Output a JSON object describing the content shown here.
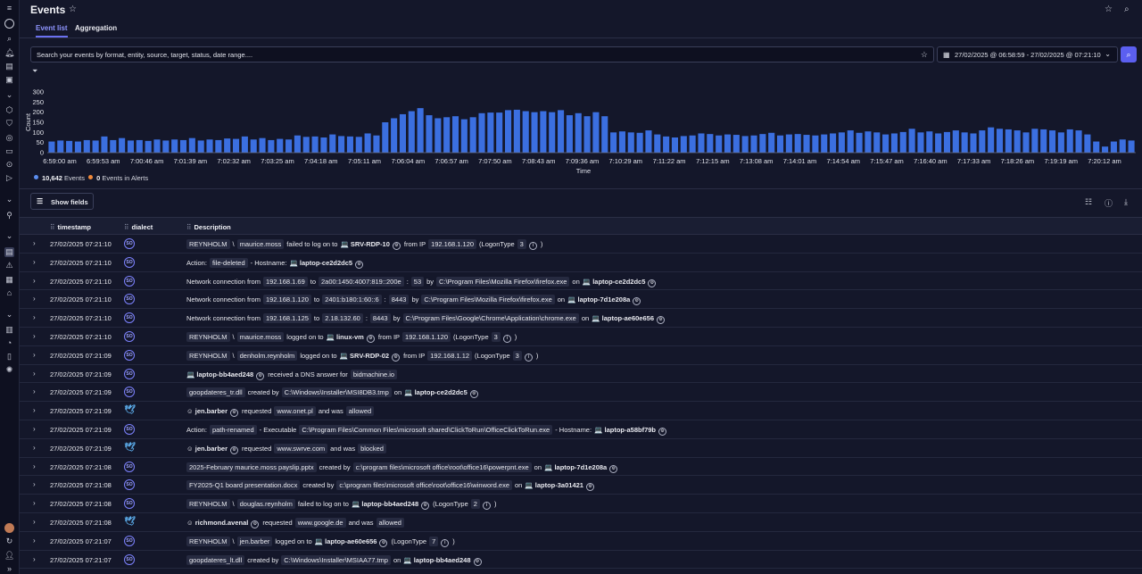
{
  "header": {
    "title": "Events"
  },
  "tabs": [
    {
      "label": "Event list"
    },
    {
      "label": "Aggregation"
    }
  ],
  "search": {
    "placeholder": "Search your events by format, entity, source, target, status, date range...."
  },
  "date_range": "27/02/2025 @ 06:58:59 - 27/02/2025 @ 07:21:10",
  "legend": {
    "events_count": "10,642",
    "events_label": "Events",
    "alerts_count": "0",
    "alerts_label": "Events in Alerts",
    "events_color": "#5b8def",
    "alerts_color": "#f0893a"
  },
  "table": {
    "show_fields_label": "Show fields",
    "columns": [
      "timestamp",
      "dialect",
      "Description"
    ]
  },
  "chart_data": {
    "type": "bar",
    "ylabel": "Count",
    "xlabel": "Time",
    "ylim": [
      0,
      300
    ],
    "yticks": [
      0,
      50,
      100,
      150,
      200,
      250,
      300
    ],
    "xticks": [
      "6:59:00 am",
      "6:59:53 am",
      "7:00:46 am",
      "7:01:39 am",
      "7:02:32 am",
      "7:03:25 am",
      "7:04:18 am",
      "7:05:11 am",
      "7:06:04 am",
      "7:06:57 am",
      "7:07:50 am",
      "7:08:43 am",
      "7:09:36 am",
      "7:10:29 am",
      "7:11:22 am",
      "7:12:15 am",
      "7:13:08 am",
      "7:14:01 am",
      "7:14:54 am",
      "7:15:47 am",
      "7:16:40 am",
      "7:17:33 am",
      "7:18:26 am",
      "7:19:19 am",
      "7:20:12 am"
    ],
    "color": "#3b6fe0",
    "values": [
      55,
      60,
      58,
      55,
      62,
      60,
      80,
      62,
      72,
      60,
      62,
      58,
      65,
      60,
      65,
      62,
      72,
      60,
      65,
      62,
      70,
      68,
      80,
      65,
      72,
      62,
      68,
      65,
      85,
      78,
      80,
      75,
      90,
      82,
      80,
      78,
      95,
      85,
      150,
      170,
      190,
      205,
      220,
      185,
      170,
      175,
      180,
      165,
      175,
      195,
      198,
      198,
      210,
      212,
      205,
      200,
      205,
      200,
      210,
      185,
      195,
      180,
      200,
      180,
      100,
      105,
      100,
      98,
      110,
      90,
      80,
      75,
      82,
      85,
      95,
      92,
      85,
      90,
      88,
      82,
      85,
      92,
      98,
      85,
      90,
      92,
      88,
      85,
      90,
      95,
      100,
      110,
      98,
      105,
      100,
      90,
      95,
      102,
      118,
      100,
      105,
      95,
      102,
      110,
      100,
      95,
      110,
      125,
      118,
      115,
      110,
      100,
      118,
      115,
      110,
      100,
      115,
      110,
      90,
      55,
      30,
      55,
      65,
      60
    ]
  },
  "rows": [
    {
      "ts": "27/02/2025 07:21:10",
      "dialect": "SO",
      "desc": [
        [
          "c",
          "REYNHOLM"
        ],
        [
          "t",
          "\\"
        ],
        [
          "c",
          "maurice.moss"
        ],
        [
          "t",
          "failed to log on to"
        ],
        [
          "h",
          "💻 SRV-RDP-10"
        ],
        [
          "o",
          "⚙"
        ],
        [
          "t",
          "from IP"
        ],
        [
          "c",
          "192.168.1.120"
        ],
        [
          "t",
          "(LogonType"
        ],
        [
          "c",
          "3"
        ],
        [
          "i",
          "i"
        ],
        [
          "t",
          ")"
        ]
      ]
    },
    {
      "ts": "27/02/2025 07:21:10",
      "dialect": "SO",
      "desc": [
        [
          "t",
          "Action:"
        ],
        [
          "c",
          "file-deleted"
        ],
        [
          "t",
          "- Hostname:"
        ],
        [
          "h",
          "💻 laptop-ce2d2dc5"
        ],
        [
          "o",
          "⚙"
        ]
      ]
    },
    {
      "ts": "27/02/2025 07:21:10",
      "dialect": "SO",
      "desc": [
        [
          "t",
          "Network connection from"
        ],
        [
          "c",
          "192.168.1.69"
        ],
        [
          "t",
          "to"
        ],
        [
          "c",
          "2a00:1450:4007:819::200e"
        ],
        [
          "t",
          ":"
        ],
        [
          "c",
          "53"
        ],
        [
          "t",
          "by"
        ],
        [
          "c",
          "C:\\Program Files\\Mozilla Firefox\\firefox.exe"
        ],
        [
          "t",
          "on"
        ],
        [
          "h",
          "💻 laptop-ce2d2dc5"
        ],
        [
          "o",
          "⚙"
        ]
      ]
    },
    {
      "ts": "27/02/2025 07:21:10",
      "dialect": "SO",
      "desc": [
        [
          "t",
          "Network connection from"
        ],
        [
          "c",
          "192.168.1.120"
        ],
        [
          "t",
          "to"
        ],
        [
          "c",
          "2401:b180:1:60::6"
        ],
        [
          "t",
          ":"
        ],
        [
          "c",
          "8443"
        ],
        [
          "t",
          "by"
        ],
        [
          "c",
          "C:\\Program Files\\Mozilla Firefox\\firefox.exe"
        ],
        [
          "t",
          "on"
        ],
        [
          "h",
          "💻 laptop-7d1e208a"
        ],
        [
          "o",
          "⚙"
        ]
      ]
    },
    {
      "ts": "27/02/2025 07:21:10",
      "dialect": "SO",
      "desc": [
        [
          "t",
          "Network connection from"
        ],
        [
          "c",
          "192.168.1.125"
        ],
        [
          "t",
          "to"
        ],
        [
          "c",
          "2.18.132.60"
        ],
        [
          "t",
          ":"
        ],
        [
          "c",
          "8443"
        ],
        [
          "t",
          "by"
        ],
        [
          "c",
          "C:\\Program Files\\Google\\Chrome\\Application\\chrome.exe"
        ],
        [
          "t",
          "on"
        ],
        [
          "h",
          "💻 laptop-ae60e656"
        ],
        [
          "o",
          "⚙"
        ]
      ]
    },
    {
      "ts": "27/02/2025 07:21:10",
      "dialect": "SO",
      "desc": [
        [
          "c",
          "REYNHOLM"
        ],
        [
          "t",
          "\\"
        ],
        [
          "c",
          "maurice.moss"
        ],
        [
          "t",
          "logged on to"
        ],
        [
          "h",
          "💻 linux-vm"
        ],
        [
          "o",
          "⚙"
        ],
        [
          "t",
          "from IP"
        ],
        [
          "c",
          "192.168.1.120"
        ],
        [
          "t",
          "(LogonType"
        ],
        [
          "c",
          "3"
        ],
        [
          "i",
          "i"
        ],
        [
          "t",
          ")"
        ]
      ]
    },
    {
      "ts": "27/02/2025 07:21:09",
      "dialect": "SO",
      "desc": [
        [
          "c",
          "REYNHOLM"
        ],
        [
          "t",
          "\\"
        ],
        [
          "c",
          "denholm.reynholm"
        ],
        [
          "t",
          "logged on to"
        ],
        [
          "h",
          "💻 SRV-RDP-02"
        ],
        [
          "o",
          "⚙"
        ],
        [
          "t",
          "from IP"
        ],
        [
          "c",
          "192.168.1.12"
        ],
        [
          "t",
          "(LogonType"
        ],
        [
          "c",
          "3"
        ],
        [
          "i",
          "i"
        ],
        [
          "t",
          ")"
        ]
      ]
    },
    {
      "ts": "27/02/2025 07:21:09",
      "dialect": "SO",
      "desc": [
        [
          "h",
          "💻 laptop-bb4aed248"
        ],
        [
          "o",
          "⚙"
        ],
        [
          "t",
          "received a DNS answer for"
        ],
        [
          "c",
          "bidmachine.io"
        ]
      ]
    },
    {
      "ts": "27/02/2025 07:21:09",
      "dialect": "SO",
      "desc": [
        [
          "c",
          "goopdateres_tr.dll"
        ],
        [
          "t",
          "created by"
        ],
        [
          "c",
          "C:\\Windows\\Installer\\MSI8DB3.tmp"
        ],
        [
          "t",
          "on"
        ],
        [
          "h",
          "💻 laptop-ce2d2dc5"
        ],
        [
          "o",
          "⚙"
        ]
      ]
    },
    {
      "ts": "27/02/2025 07:21:09",
      "dialect": "bird",
      "desc": [
        [
          "h",
          "☺ jen.barber"
        ],
        [
          "o",
          "⚙"
        ],
        [
          "t",
          "requested"
        ],
        [
          "c",
          "www.onet.pl"
        ],
        [
          "t",
          "and was"
        ],
        [
          "c",
          "allowed"
        ]
      ]
    },
    {
      "ts": "27/02/2025 07:21:09",
      "dialect": "SO",
      "desc": [
        [
          "t",
          "Action:"
        ],
        [
          "c",
          "path-renamed"
        ],
        [
          "t",
          "- Executable"
        ],
        [
          "c",
          "C:\\Program Files\\Common Files\\microsoft shared\\ClickToRun\\OfficeClickToRun.exe"
        ],
        [
          "t",
          "- Hostname:"
        ],
        [
          "h",
          "💻 laptop-a58bf79b"
        ],
        [
          "o",
          "⚙"
        ]
      ]
    },
    {
      "ts": "27/02/2025 07:21:09",
      "dialect": "bird",
      "desc": [
        [
          "h",
          "☺ jen.barber"
        ],
        [
          "o",
          "⚙"
        ],
        [
          "t",
          "requested"
        ],
        [
          "c",
          "www.swrve.com"
        ],
        [
          "t",
          "and was"
        ],
        [
          "c",
          "blocked"
        ]
      ]
    },
    {
      "ts": "27/02/2025 07:21:08",
      "dialect": "SO",
      "desc": [
        [
          "c",
          "2025-February maurice.moss payslip.pptx"
        ],
        [
          "t",
          "created by"
        ],
        [
          "c",
          "c:\\program files\\microsoft office\\root\\office16\\powerpnt.exe"
        ],
        [
          "t",
          "on"
        ],
        [
          "h",
          "💻 laptop-7d1e208a"
        ],
        [
          "o",
          "⚙"
        ]
      ]
    },
    {
      "ts": "27/02/2025 07:21:08",
      "dialect": "SO",
      "desc": [
        [
          "c",
          "FY2025-Q1 board presentation.docx"
        ],
        [
          "t",
          "created by"
        ],
        [
          "c",
          "c:\\program files\\microsoft office\\root\\office16\\winword.exe"
        ],
        [
          "t",
          "on"
        ],
        [
          "h",
          "💻 laptop-3a01421"
        ],
        [
          "o",
          "⚙"
        ]
      ]
    },
    {
      "ts": "27/02/2025 07:21:08",
      "dialect": "SO",
      "desc": [
        [
          "c",
          "REYNHOLM"
        ],
        [
          "t",
          "\\"
        ],
        [
          "c",
          "douglas.reynholm"
        ],
        [
          "t",
          "failed to log on to"
        ],
        [
          "h",
          "💻 laptop-bb4aed248"
        ],
        [
          "o",
          "⚙"
        ],
        [
          "t",
          "(LogonType"
        ],
        [
          "c",
          "2"
        ],
        [
          "i",
          "i"
        ],
        [
          "t",
          ")"
        ]
      ]
    },
    {
      "ts": "27/02/2025 07:21:08",
      "dialect": "bird",
      "desc": [
        [
          "h",
          "☺ richmond.avenal"
        ],
        [
          "o",
          "⚙"
        ],
        [
          "t",
          "requested"
        ],
        [
          "c",
          "www.google.de"
        ],
        [
          "t",
          "and was"
        ],
        [
          "c",
          "allowed"
        ]
      ]
    },
    {
      "ts": "27/02/2025 07:21:07",
      "dialect": "SO",
      "desc": [
        [
          "c",
          "REYNHOLM"
        ],
        [
          "t",
          "\\"
        ],
        [
          "c",
          "jen.barber"
        ],
        [
          "t",
          "logged on to"
        ],
        [
          "h",
          "💻 laptop-ae60e656"
        ],
        [
          "o",
          "⚙"
        ],
        [
          "t",
          "(LogonType"
        ],
        [
          "c",
          "7"
        ],
        [
          "i",
          "i"
        ],
        [
          "t",
          ")"
        ]
      ]
    },
    {
      "ts": "27/02/2025 07:21:07",
      "dialect": "SO",
      "desc": [
        [
          "c",
          "goopdateres_lt.dll"
        ],
        [
          "t",
          "created by"
        ],
        [
          "c",
          "C:\\Windows\\Installer\\MSIAA77.tmp"
        ],
        [
          "t",
          "on"
        ],
        [
          "h",
          "💻 laptop-bb4aed248"
        ],
        [
          "o",
          "⚙"
        ]
      ]
    }
  ]
}
